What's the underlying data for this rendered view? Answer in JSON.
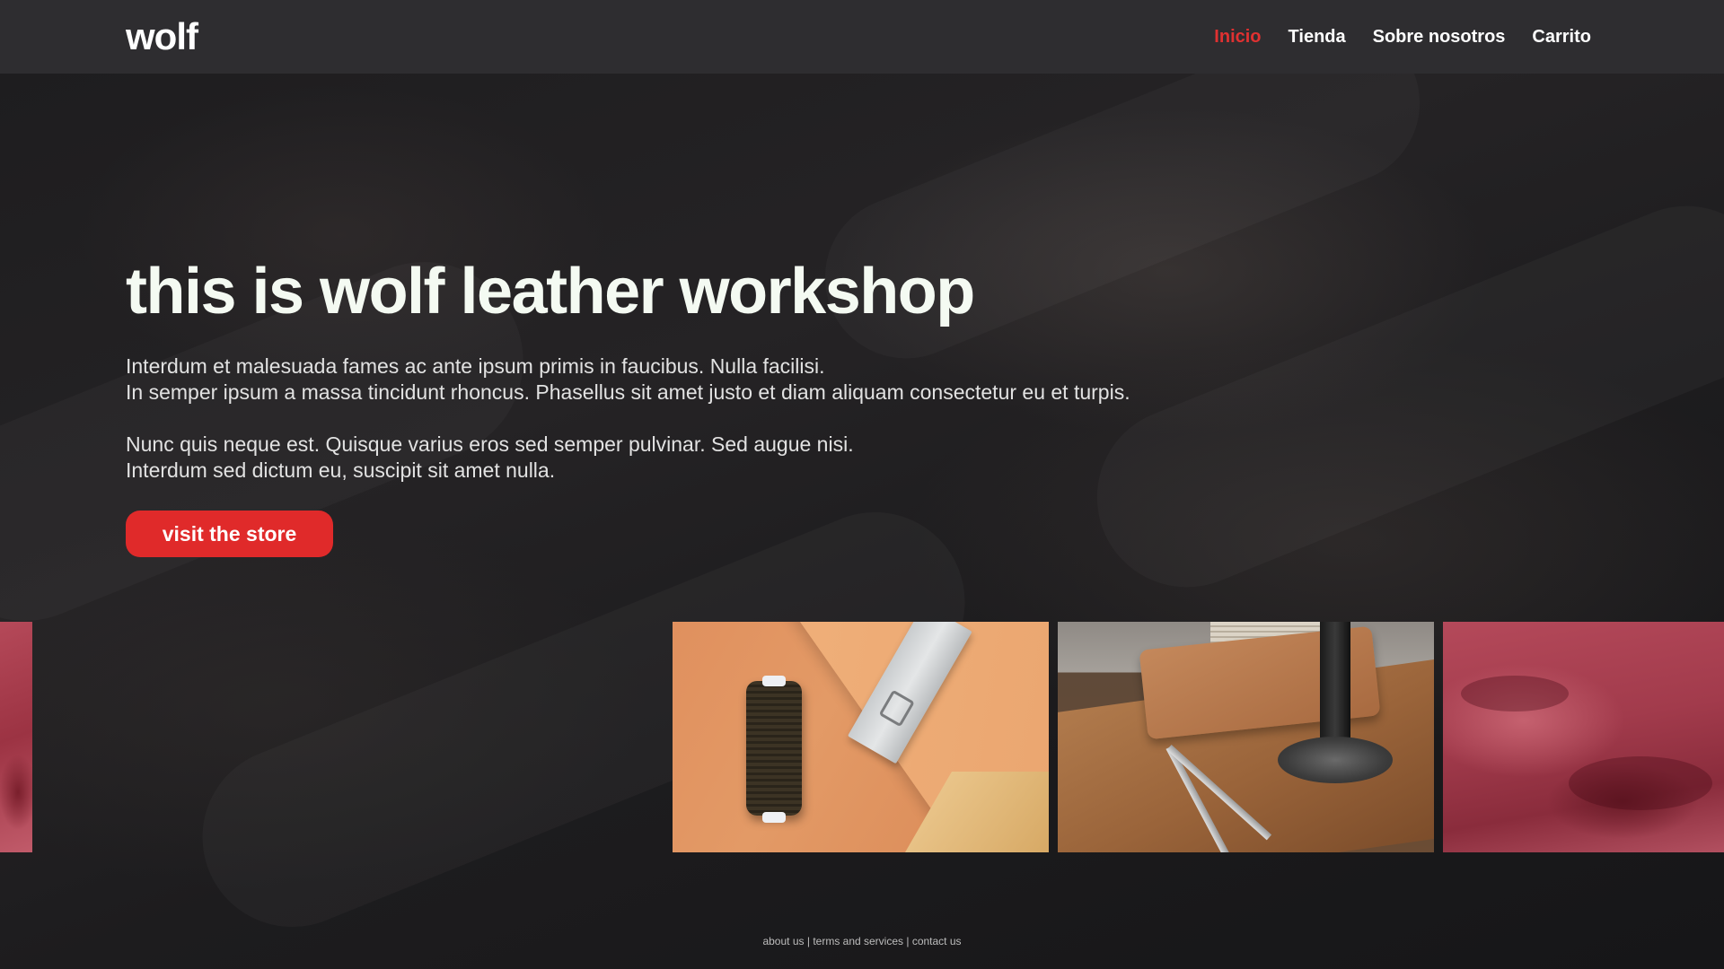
{
  "nav": {
    "logo": "wolf",
    "links": [
      {
        "label": "Inicio",
        "active": true
      },
      {
        "label": "Tienda",
        "active": false
      },
      {
        "label": "Sobre nosotros",
        "active": false
      },
      {
        "label": "Carrito",
        "active": false
      }
    ]
  },
  "hero": {
    "title": "this is wolf leather workshop",
    "paragraph1_line1": "Interdum et malesuada fames ac ante ipsum primis in faucibus. Nulla facilisi.",
    "paragraph1_line2": "In semper ipsum a massa tincidunt rhoncus. Phasellus sit amet justo et diam aliquam consectetur eu et turpis.",
    "paragraph2_line1": "Nunc quis neque est. Quisque varius eros sed semper pulvinar. Sed augue nisi.",
    "paragraph2_line2": "Interdum sed dictum eu, suscipit sit amet nulla.",
    "cta_label": "visit the store"
  },
  "gallery": {
    "images": [
      {
        "subject": "red leather"
      },
      {
        "subject": "thread spool and ruler on leather"
      },
      {
        "subject": "workbench with compass and leather bag"
      },
      {
        "subject": "red leather hides"
      }
    ]
  },
  "footer": {
    "links": [
      {
        "label": "about us"
      },
      {
        "label": "terms and services"
      },
      {
        "label": "contact us"
      }
    ],
    "separator": "|"
  },
  "colors": {
    "accent": "#e02a2a",
    "nav_bg": "#2e2d30",
    "page_bg": "#17171a"
  }
}
